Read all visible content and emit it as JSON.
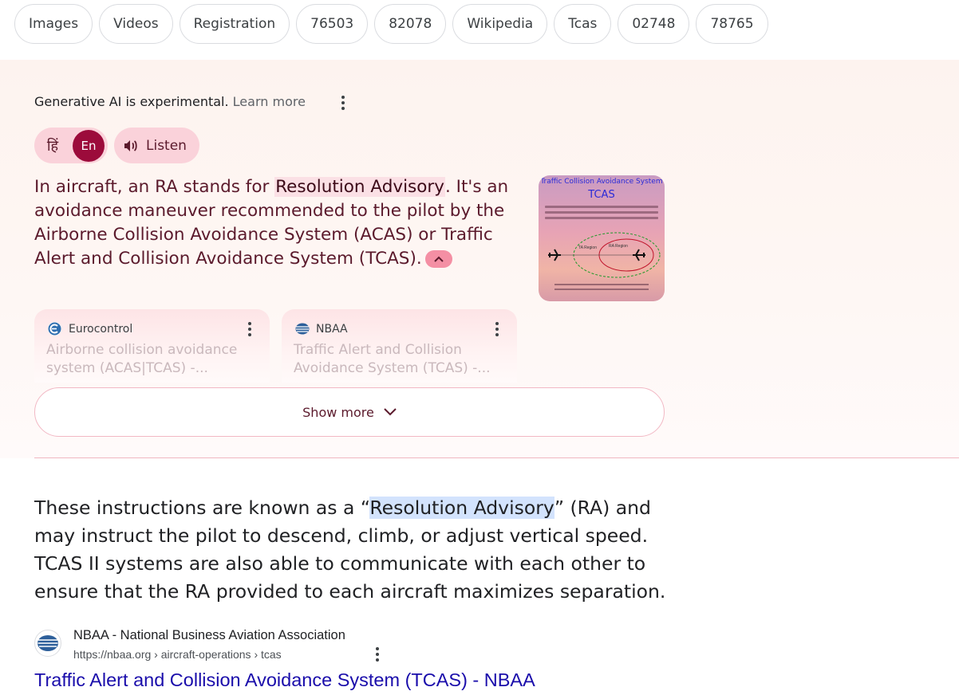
{
  "chips": [
    "Images",
    "Videos",
    "Registration",
    "76503",
    "82078",
    "Wikipedia",
    "Tcas",
    "02748",
    "78765"
  ],
  "ai_overview": {
    "header_text": "Generative AI is experimental.",
    "learn_more": "Learn more",
    "lang_hindi": "हिं",
    "lang_english": "En",
    "listen_label": "Listen",
    "text_before": "In aircraft, an RA stands for ",
    "text_highlight": "Resolution Advisory",
    "text_after": ". It's an avoidance maneuver recommended to the pilot by the Airborne Collision Avoidance System (ACAS) or Traffic Alert and Collision Avoidance System (TCAS).",
    "thumbnail": {
      "title_line1": "Traffic Collision Avoidance System",
      "title_line2": "TCAS",
      "ta_label": "TA Region",
      "ra_label": "RA Region"
    },
    "sources": [
      {
        "name": "Eurocontrol",
        "title": "Airborne collision avoidance system (ACAS|TCAS) -..."
      },
      {
        "name": "NBAA",
        "title": "Traffic Alert and Collision Avoidance System (TCAS) -..."
      }
    ],
    "show_more": "Show more"
  },
  "snippet": {
    "before": "These instructions are known as a “",
    "highlight": "Resolution Advisory",
    "after": "” (RA) and may instruct the pilot to descend, climb, or adjust vertical speed. TCAS II systems are also able to communicate with each other to ensure that the RA provided to each aircraft maximizes separation."
  },
  "result": {
    "site_name": "NBAA - National Business Aviation Association",
    "url": "https://nbaa.org › aircraft-operations › tcas",
    "title": "Traffic Alert and Collision Avoidance System (TCAS) - NBAA"
  },
  "colors": {
    "accent": "#9c0b3b",
    "pill_bg": "#fad2da",
    "ai_text": "#5b1a2c",
    "link": "#1a0dab",
    "snippet_highlight": "#d3e3fd"
  }
}
